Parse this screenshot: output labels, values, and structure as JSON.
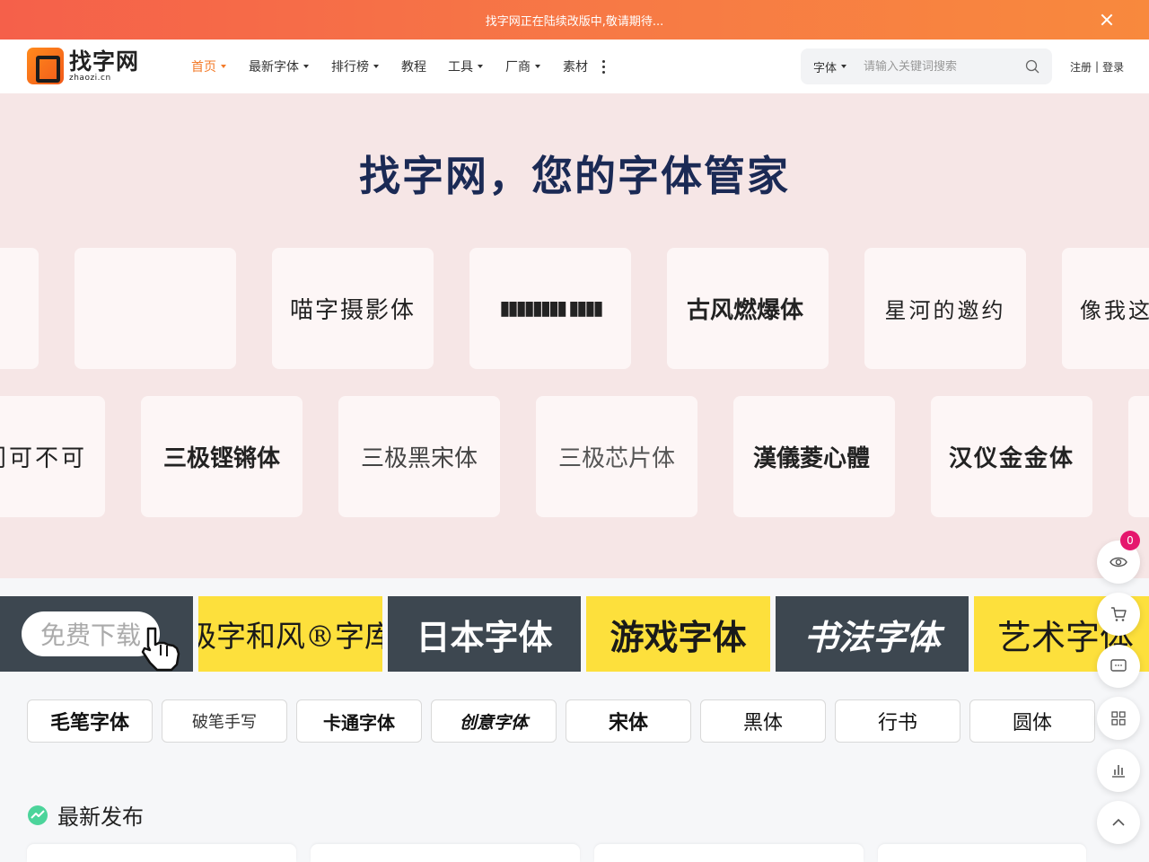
{
  "notice": {
    "text": "找字网正在陆续改版中,敬请期待..."
  },
  "header": {
    "logo_cn": "找字网",
    "logo_en": "zhaozi.cn",
    "nav": [
      {
        "label": "首页",
        "has_menu": true,
        "active": true
      },
      {
        "label": "最新字体",
        "has_menu": true
      },
      {
        "label": "排行榜",
        "has_menu": true
      },
      {
        "label": "教程",
        "has_menu": false
      },
      {
        "label": "工具",
        "has_menu": true
      },
      {
        "label": "厂商",
        "has_menu": true
      },
      {
        "label": "素材",
        "has_menu": false
      }
    ],
    "search_type": "字体",
    "search_placeholder": "请输入关键词搜索",
    "register": "注册",
    "separator": "|",
    "login": "登录"
  },
  "hero": {
    "title": "找字网，您的字体管家",
    "row1": [
      "",
      "",
      "喵字摄影体",
      "▮▮▮▮▮▮▮▮ ▮▮▮▮",
      "古风燃爆体",
      "星河的邀约",
      "像我这"
    ],
    "row2": [
      "门可不可",
      "三极铿锵体",
      "三极黑宋体",
      "三极芯片体",
      "漢儀菱心體",
      "汉仪金金体",
      ""
    ]
  },
  "banners": {
    "free_download": "免费下载",
    "tiles": [
      {
        "label": "极字和风®字库",
        "style": "yellow"
      },
      {
        "label": "日本字体",
        "style": "dark"
      },
      {
        "label": "游戏字体",
        "style": "yellow"
      },
      {
        "label": "书法字体",
        "style": "dark"
      },
      {
        "label": "艺术字体",
        "style": "yellow"
      }
    ]
  },
  "categories": [
    "毛笔字体",
    "破笔手写",
    "卡通字体",
    "创意字体",
    "宋体",
    "黑体",
    "行书",
    "圆体"
  ],
  "latest": {
    "title": "最新发布"
  },
  "sidebar": {
    "cart_count": "0"
  },
  "colors": {
    "accent": "#f37b2a",
    "hero_bg": "#f6e6e6",
    "badge": "#e5176d",
    "title": "#1b2a55"
  }
}
